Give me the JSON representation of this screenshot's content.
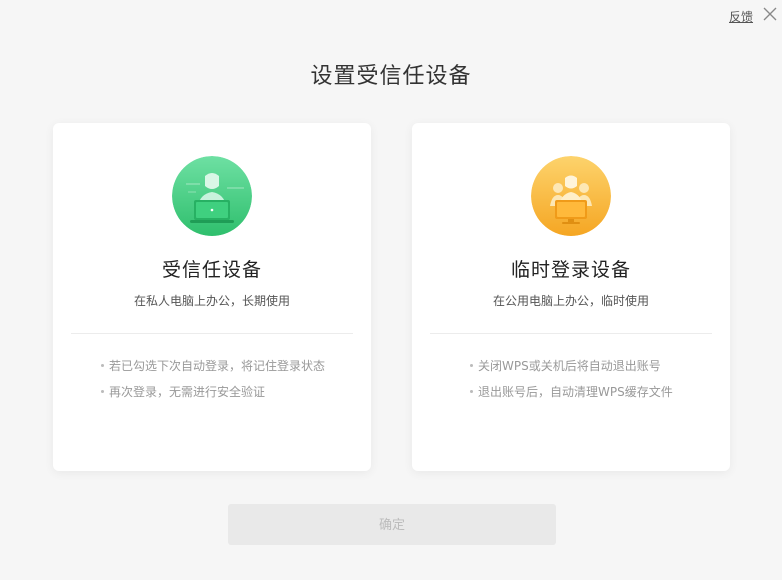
{
  "topbar": {
    "feedback_label": "反馈",
    "close_icon": "close-icon"
  },
  "page": {
    "title": "设置受信任设备"
  },
  "cards": [
    {
      "title": "受信任设备",
      "subtitle": "在私人电脑上办公，长期使用",
      "icon": "trusted-device-icon",
      "accent": "#3cc97a",
      "bullets": [
        "若已勾选下次自动登录，将记住登录状态",
        "再次登录，无需进行安全验证"
      ]
    },
    {
      "title": "临时登录设备",
      "subtitle": "在公用电脑上办公，临时使用",
      "icon": "temporary-device-icon",
      "accent": "#f9b52f",
      "bullets": [
        "关闭WPS或关机后将自动退出账号",
        "退出账号后，自动清理WPS缓存文件"
      ]
    }
  ],
  "footer": {
    "confirm_label": "确定"
  },
  "colors": {
    "background": "#f6f6f6",
    "card": "#ffffff",
    "button_disabled_bg": "#e9e9e9",
    "button_disabled_text": "#bcbcbc"
  }
}
